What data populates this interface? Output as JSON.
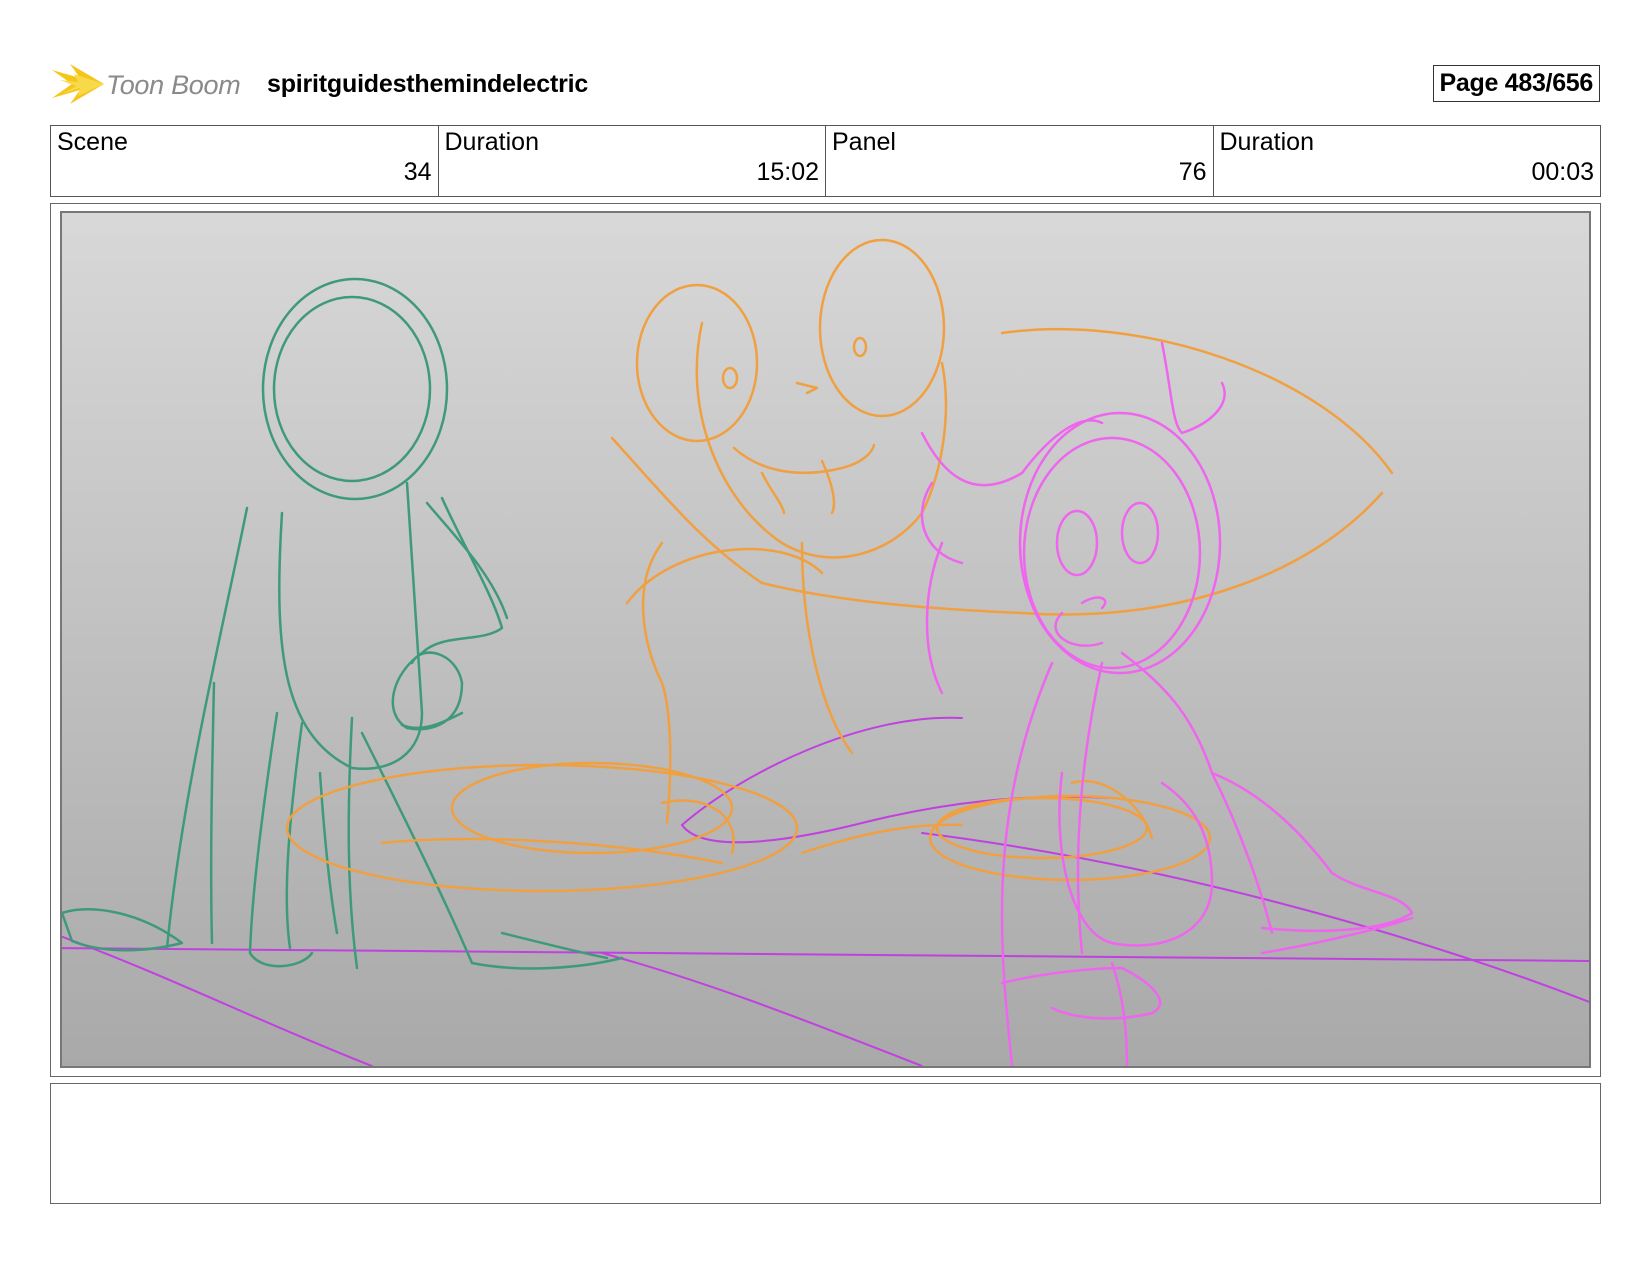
{
  "header": {
    "logo_text": "Toon Boom",
    "project_title": "spiritguidesthemindelectric",
    "page_label": "Page 483/656"
  },
  "info": [
    {
      "label": "Scene",
      "value": "34"
    },
    {
      "label": "Duration",
      "value": "15:02"
    },
    {
      "label": "Panel",
      "value": "76"
    },
    {
      "label": "Duration",
      "value": "00:03"
    }
  ],
  "sketch": {
    "colors": {
      "figure_left": "#3f9a7a",
      "figure_middle": "#f0a040",
      "figure_right": "#ee66ee",
      "ground_lines": "#c040e0"
    }
  },
  "notes": {
    "text": ""
  }
}
